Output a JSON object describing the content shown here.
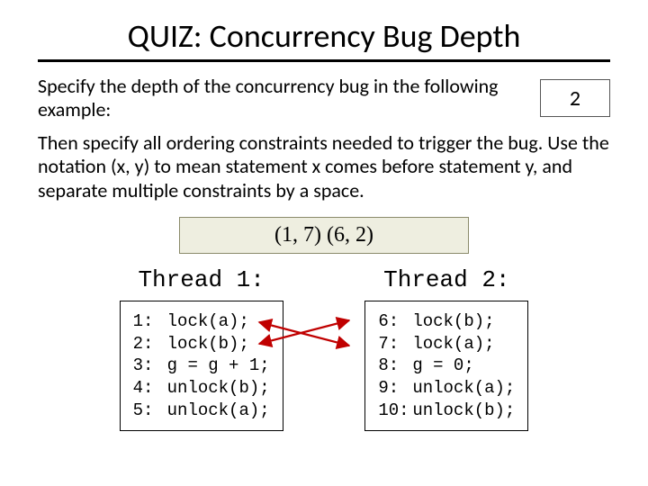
{
  "title": "QUIZ: Concurrency Bug Depth",
  "prompt1": "Specify the depth of the concurrency bug in the following example:",
  "depth_answer": "2",
  "prompt2": "Then specify all ordering constraints needed to trigger the bug. Use the notation (x, y) to mean statement x comes before statement y, and separate multiple constraints by a space.",
  "constraints_answer": "(1, 7)  (6, 2)",
  "thread1": {
    "title": "Thread 1:",
    "lines": [
      {
        "n": "1:",
        "code": "lock(a);"
      },
      {
        "n": "2:",
        "code": "lock(b);"
      },
      {
        "n": "3:",
        "code": "g = g + 1;"
      },
      {
        "n": "4:",
        "code": "unlock(b);"
      },
      {
        "n": "5:",
        "code": "unlock(a);"
      }
    ]
  },
  "thread2": {
    "title": "Thread 2:",
    "lines": [
      {
        "n": "6:",
        "code": "lock(b);"
      },
      {
        "n": "7:",
        "code": "lock(a);"
      },
      {
        "n": "8:",
        "code": "g = 0;"
      },
      {
        "n": "9:",
        "code": "unlock(a);"
      },
      {
        "n": "10:",
        "code": "unlock(b);"
      }
    ]
  }
}
